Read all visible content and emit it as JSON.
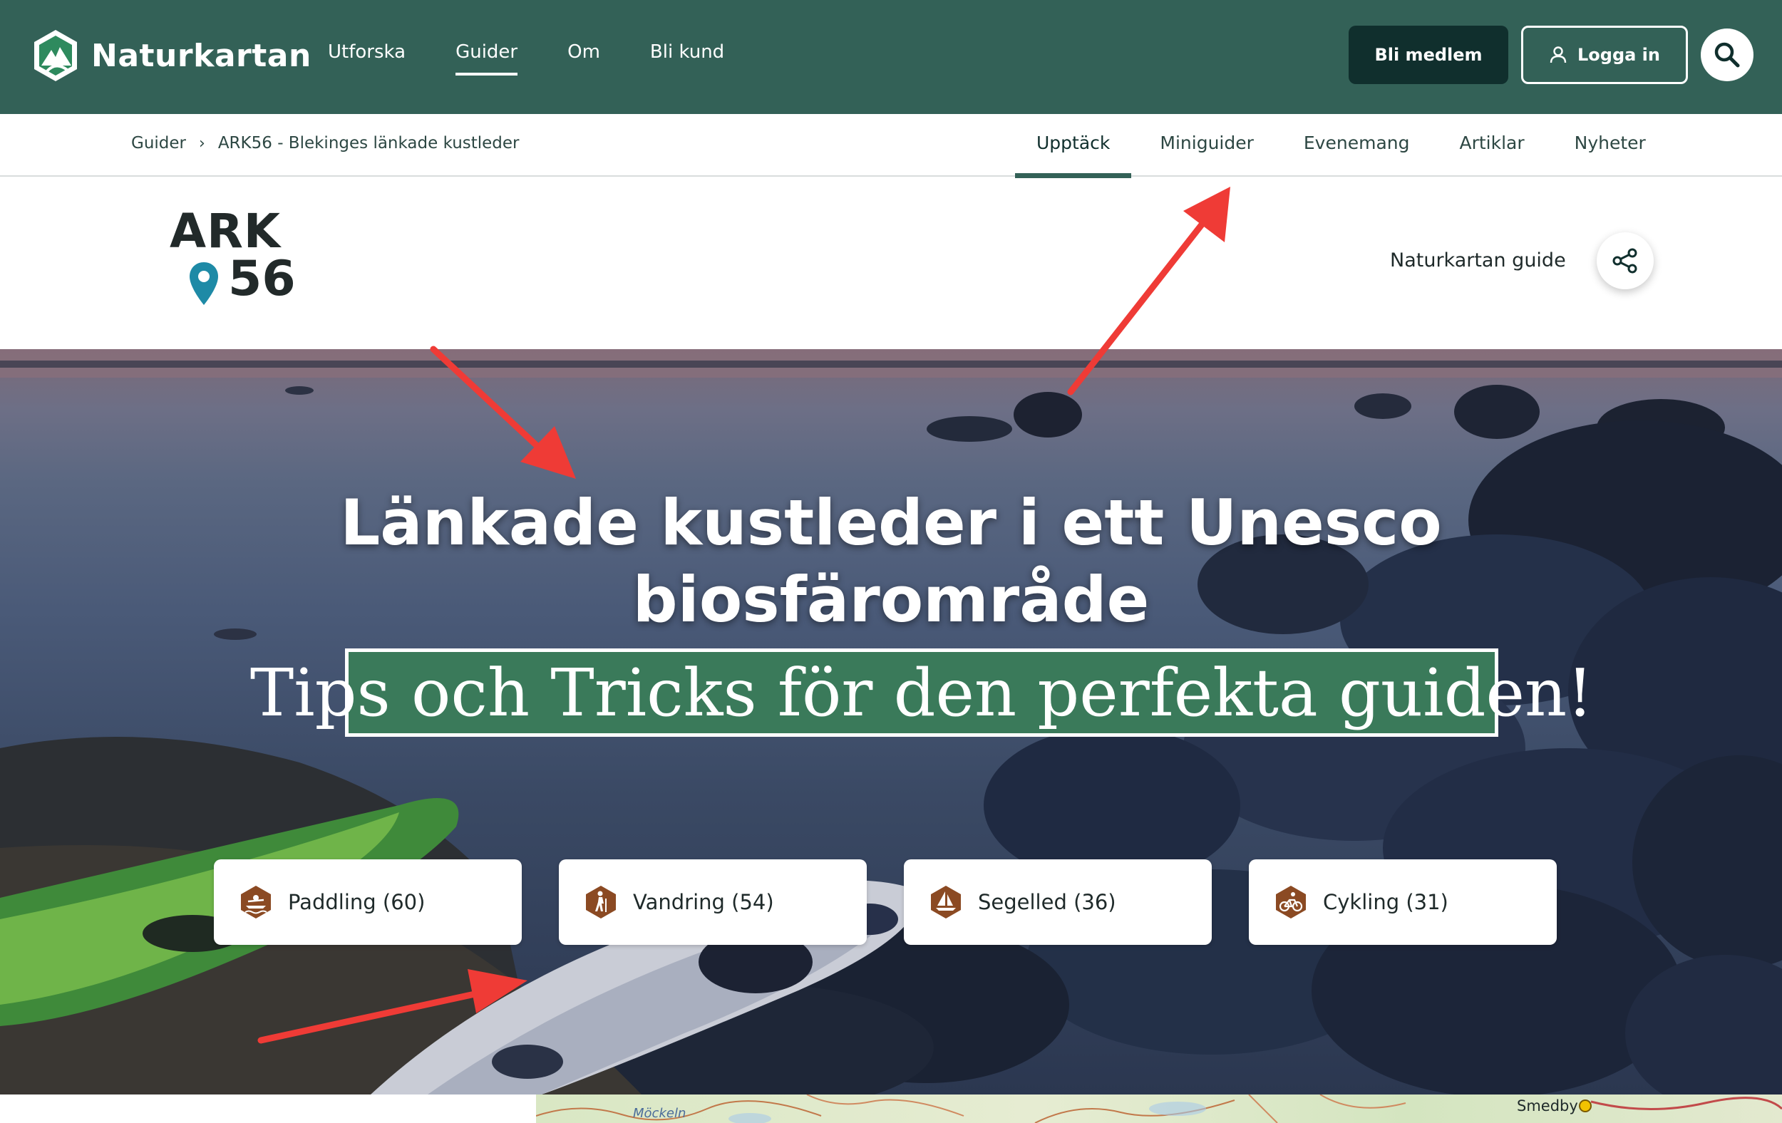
{
  "header": {
    "brand": "Naturkartan",
    "nav": [
      {
        "label": "Utforska",
        "active": false
      },
      {
        "label": "Guider",
        "active": true
      },
      {
        "label": "Om",
        "active": false
      },
      {
        "label": "Bli kund",
        "active": false
      }
    ],
    "member_button": "Bli medlem",
    "login_button": "Logga in",
    "search_icon": "search-icon"
  },
  "subnav": {
    "breadcrumb": [
      "Guider",
      "ARK56 - Blekinges länkade kustleder"
    ],
    "tabs": [
      {
        "label": "Upptäck",
        "active": true
      },
      {
        "label": "Miniguider",
        "active": false
      },
      {
        "label": "Evenemang",
        "active": false
      },
      {
        "label": "Artiklar",
        "active": false
      },
      {
        "label": "Nyheter",
        "active": false
      }
    ]
  },
  "guide": {
    "logo_top": "ARK",
    "logo_number": "56",
    "label": "Naturkartan guide",
    "share_icon": "share-icon"
  },
  "hero": {
    "title_line1": "Länkade kustleder i ett Unesco",
    "title_line2": "biosfärområde",
    "banner": "Tips och Tricks för den perfekta guiden!",
    "activities": [
      {
        "label": "Paddling (60)",
        "icon": "paddling-icon"
      },
      {
        "label": "Vandring (54)",
        "icon": "hiking-icon"
      },
      {
        "label": "Segelled (36)",
        "icon": "sailing-icon"
      },
      {
        "label": "Cykling (31)",
        "icon": "cycling-icon"
      }
    ]
  },
  "map": {
    "labels": [
      "Möckeln",
      "Smedby"
    ]
  },
  "colors": {
    "header_bg": "#336157",
    "member_button_bg": "#102f2d",
    "banner_bg": "#3a7a5a",
    "activity_icon": "#8b4a23",
    "annotation_arrow": "#ef3b36"
  }
}
